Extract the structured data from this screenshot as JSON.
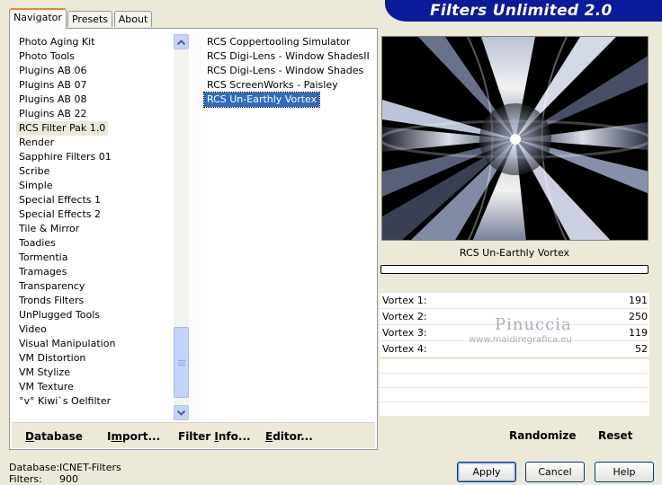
{
  "header": {
    "title": "Filters Unlimited 2.0"
  },
  "tabs": [
    {
      "label": "Navigator",
      "active": true
    },
    {
      "label": "Presets",
      "active": false
    },
    {
      "label": "About",
      "active": false
    }
  ],
  "categories": [
    "Photo Aging Kit",
    "Photo Tools",
    "Plugins AB 06",
    "Plugins AB 07",
    "Plugins AB 08",
    "Plugins AB 22",
    "RCS Filter Pak 1.0",
    "Render",
    "Sapphire Filters 01",
    "Scribe",
    "Simple",
    "Special Effects 1",
    "Special Effects 2",
    "Tile & Mirror",
    "Toadies",
    "Tormentia",
    "Tramages",
    "Transparency",
    "Tronds Filters",
    "UnPlugged Tools",
    "Video",
    "Visual Manipulation",
    "VM Distortion",
    "VM Stylize",
    "VM Texture",
    "°v° Kiwi`s Oelfilter"
  ],
  "selected_category": "RCS Filter Pak 1.0",
  "filters": [
    "RCS Coppertooling Simulator",
    "RCS Digi-Lens - Window ShadesII",
    "RCS Digi-Lens - Window Shades",
    "RCS ScreenWorks - Paisley",
    "RCS Un-Earthly Vortex"
  ],
  "selected_filter": "RCS Un-Earthly Vortex",
  "nav_buttons": {
    "database": {
      "ul": "D",
      "rest": "atabase"
    },
    "import": {
      "pre": "I",
      "ul": "m",
      "rest": "port..."
    },
    "filter_info": {
      "pre": "Filter ",
      "ul": "I",
      "rest": "nfo..."
    },
    "editor": {
      "ul": "E",
      "rest": "ditor..."
    }
  },
  "preview": {
    "filter_name": "RCS Un-Earthly Vortex",
    "progress": 0
  },
  "params": [
    {
      "label": "Vortex 1:",
      "value": "191"
    },
    {
      "label": "Vortex 2:",
      "value": "250"
    },
    {
      "label": "Vortex 3:",
      "value": "119"
    },
    {
      "label": "Vortex 4:",
      "value": "52"
    }
  ],
  "right_buttons": {
    "randomize": "Randomize",
    "reset": "Reset"
  },
  "status": {
    "database_label": "Database:",
    "database_value": "ICNET-Filters",
    "filters_label": "Filters:",
    "filters_value": "900"
  },
  "footer_buttons": {
    "apply": "Apply",
    "cancel": "Cancel",
    "help": "Help"
  },
  "watermark": {
    "line1": "Pinuccia",
    "line2": "www.maidiregrafica.eu"
  }
}
